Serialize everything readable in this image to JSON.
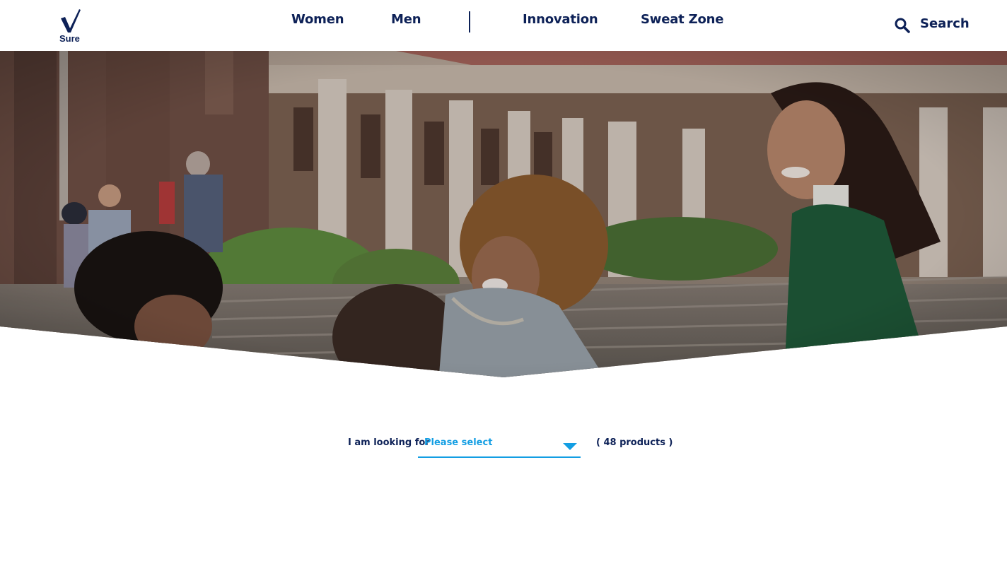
{
  "brand": {
    "logo_text": "Sure"
  },
  "nav": {
    "items": [
      {
        "label": "Women"
      },
      {
        "label": "Men"
      },
      {
        "label": "Innovation"
      },
      {
        "label": "Sweat Zone"
      }
    ],
    "search_label": "Search"
  },
  "hero": {
    "image": "students-laughing-on-campus-steps-photo"
  },
  "filter": {
    "label": "I am looking for",
    "select_value": "Please select",
    "product_count": "( 48 products )"
  },
  "colors": {
    "navy": "#0d2157",
    "accent": "#139ee3"
  }
}
